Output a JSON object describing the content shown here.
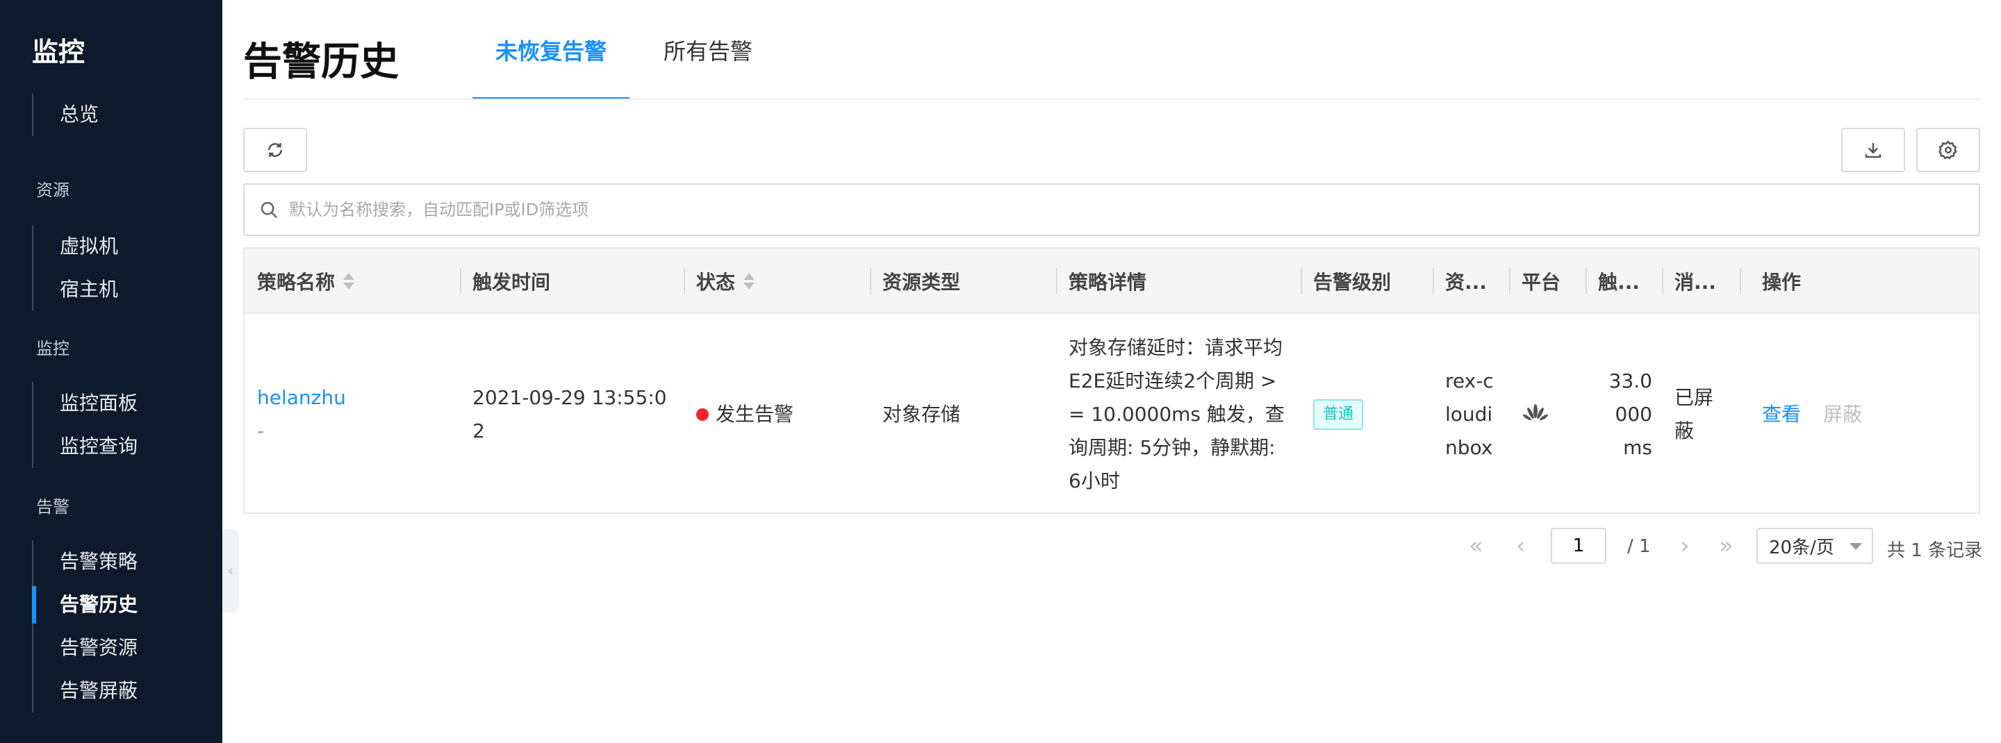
{
  "sidebar": {
    "brand": "监控",
    "overview": "总览",
    "sections": [
      {
        "title": "资源",
        "items": [
          "虚拟机",
          "宿主机"
        ]
      },
      {
        "title": "监控",
        "items": [
          "监控面板",
          "监控查询"
        ]
      },
      {
        "title": "告警",
        "items": [
          "告警策略",
          "告警历史",
          "告警资源",
          "告警屏蔽"
        ]
      }
    ],
    "active_item": "告警历史"
  },
  "header": {
    "title": "告警历史",
    "tabs": [
      {
        "label": "未恢复告警",
        "active": true
      },
      {
        "label": "所有告警",
        "active": false
      }
    ]
  },
  "search": {
    "placeholder": "默认为名称搜索，自动匹配IP或ID筛选项"
  },
  "table": {
    "columns": [
      "策略名称",
      "触发时间",
      "状态",
      "资源类型",
      "策略详情",
      "告警级别",
      "资...",
      "平台",
      "触...",
      "消...",
      "操作"
    ],
    "rows": [
      {
        "policy_name": "helanzhu",
        "policy_sub": "-",
        "trigger_time": "2021-09-29 13:55:02",
        "status": "发生告警",
        "resource_type": "对象存储",
        "policy_detail": "对象存储延时：请求平均E2E延时连续2个周期 >= 10.0000ms 触发，查询周期: 5分钟，静默期: 6小时",
        "level": "普通",
        "resource": "rex-cloudinbox",
        "platform": "huawei-icon",
        "trigger_value": "33.0000 ms",
        "silence": "已屏蔽",
        "actions": [
          "查看",
          "屏蔽"
        ]
      }
    ]
  },
  "pagination": {
    "current_page": "1",
    "total_pages": "/ 1",
    "page_size": "20条/页",
    "total": "共 1 条记录"
  },
  "colors": {
    "sidebar_bg": "#0c1a2b",
    "accent": "#1890ff",
    "status_alert": "#f5222d",
    "badge": "#13c2c2"
  }
}
